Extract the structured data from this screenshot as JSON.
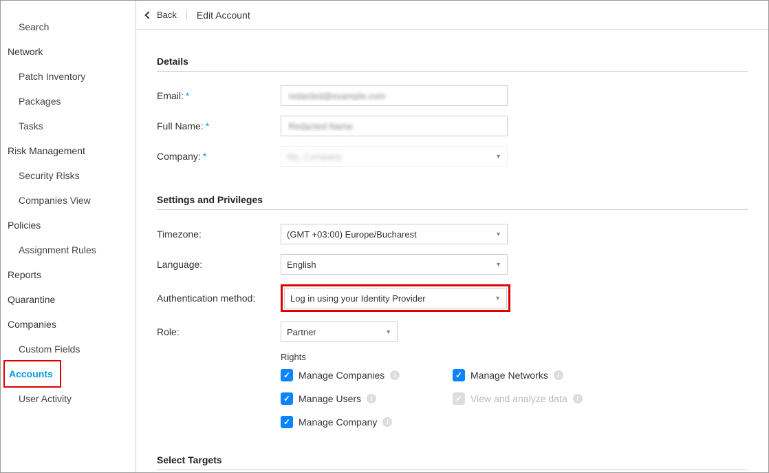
{
  "sidebar": {
    "items": [
      {
        "label": "Search",
        "type": "sub"
      },
      {
        "label": "Network",
        "type": "top"
      },
      {
        "label": "Patch Inventory",
        "type": "sub"
      },
      {
        "label": "Packages",
        "type": "sub"
      },
      {
        "label": "Tasks",
        "type": "sub"
      },
      {
        "label": "Risk Management",
        "type": "top"
      },
      {
        "label": "Security Risks",
        "type": "sub"
      },
      {
        "label": "Companies View",
        "type": "sub"
      },
      {
        "label": "Policies",
        "type": "top"
      },
      {
        "label": "Assignment Rules",
        "type": "sub"
      },
      {
        "label": "Reports",
        "type": "top"
      },
      {
        "label": "Quarantine",
        "type": "top"
      },
      {
        "label": "Companies",
        "type": "top"
      },
      {
        "label": "Custom Fields",
        "type": "sub"
      },
      {
        "label": "Accounts",
        "type": "top",
        "active": true,
        "highlight": true
      },
      {
        "label": "User Activity",
        "type": "sub"
      }
    ]
  },
  "topbar": {
    "back": "Back",
    "title": "Edit Account"
  },
  "sections": {
    "details": "Details",
    "settings": "Settings and Privileges",
    "targets": "Select Targets"
  },
  "details": {
    "email_label": "Email:",
    "email_value": "redacted@example.com",
    "fullname_label": "Full Name:",
    "fullname_value": "Redacted Name",
    "company_label": "Company:",
    "company_value": "My_Company"
  },
  "settings": {
    "timezone_label": "Timezone:",
    "timezone_value": "(GMT +03:00) Europe/Bucharest",
    "language_label": "Language:",
    "language_value": "English",
    "auth_label": "Authentication method:",
    "auth_value": "Log in using your Identity Provider",
    "role_label": "Role:",
    "role_value": "Partner"
  },
  "rights": {
    "header": "Rights",
    "items": [
      {
        "label": "Manage Companies",
        "checked": true,
        "disabled": false
      },
      {
        "label": "Manage Networks",
        "checked": true,
        "disabled": false
      },
      {
        "label": "Manage Users",
        "checked": true,
        "disabled": false
      },
      {
        "label": "View and analyze data",
        "checked": true,
        "disabled": true
      },
      {
        "label": "Manage Company",
        "checked": true,
        "disabled": false
      }
    ]
  }
}
